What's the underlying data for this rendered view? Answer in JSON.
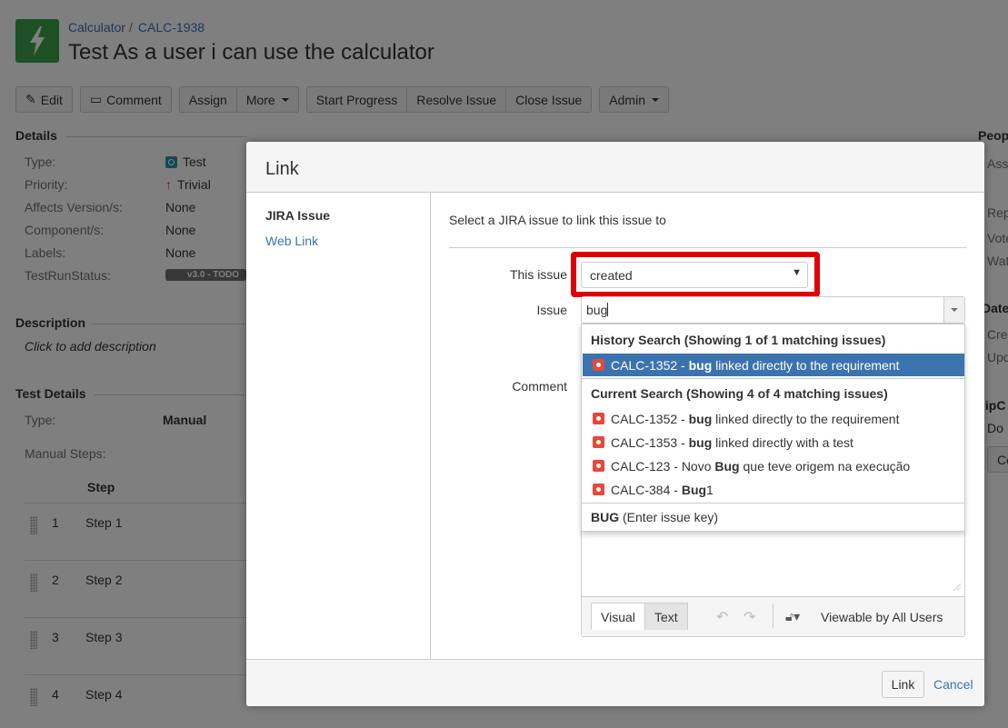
{
  "header": {
    "project": "Calculator",
    "breadcrumb_sep": "/",
    "issue_key": "CALC-1938",
    "title": "Test As a user i can use the calculator"
  },
  "toolbar": {
    "edit": "Edit",
    "comment": "Comment",
    "assign": "Assign",
    "more": "More",
    "start_progress": "Start Progress",
    "resolve_issue": "Resolve Issue",
    "close_issue": "Close Issue",
    "admin": "Admin"
  },
  "details": {
    "heading": "Details",
    "type_label": "Type:",
    "type_value": "Test",
    "priority_label": "Priority:",
    "priority_value": "Trivial",
    "affects_label": "Affects Version/s:",
    "affects_value": "None",
    "component_label": "Component/s:",
    "component_value": "None",
    "labels_label": "Labels:",
    "labels_value": "None",
    "testrun_label": "TestRunStatus:",
    "testrun_value": "v3.0 - TODO"
  },
  "description": {
    "heading": "Description",
    "placeholder": "Click to add description"
  },
  "test_details": {
    "heading": "Test Details",
    "type_label": "Type:",
    "type_value": "Manual",
    "manual_steps_label": "Manual Steps:",
    "step_header": "Step",
    "steps": [
      {
        "num": "1",
        "name": "Step 1"
      },
      {
        "num": "2",
        "name": "Step 2"
      },
      {
        "num": "3",
        "name": "Step 3"
      },
      {
        "num": "4",
        "name": "Step 4"
      }
    ]
  },
  "right_column": {
    "people_heading": "Peop",
    "assignee": "Ass",
    "reporter": "Rep",
    "votes": "Vote",
    "watchers": "Wat",
    "dates_heading": "Dates",
    "created": "Cre",
    "updated": "Upd",
    "hipchat_heading": "lipC",
    "do": "Do",
    "button": "Co"
  },
  "dialog": {
    "title": "Link",
    "nav": {
      "jira_issue": "JIRA Issue",
      "web_link": "Web Link"
    },
    "intro": "Select a JIRA issue to link this issue to",
    "this_issue_label": "This issue",
    "this_issue_value": "created",
    "issue_label": "Issue",
    "issue_value": "bug",
    "comment_label": "Comment",
    "suggestions": {
      "history_heading": "History Search (Showing 1 of 1 matching issues)",
      "history_item": {
        "key": "CALC-1352",
        "pre": " - ",
        "match": "bug",
        "post": " linked directly to the requirement"
      },
      "current_heading": "Current Search (Showing 4 of 4 matching issues)",
      "current_items": [
        {
          "key": "CALC-1352",
          "pre": " - ",
          "match": "bug",
          "post": " linked directly to the requirement"
        },
        {
          "key": "CALC-1353",
          "pre": " - ",
          "match": "bug",
          "post": " linked directly with a test"
        },
        {
          "key": "CALC-123",
          "pre": " - Novo ",
          "match": "Bug",
          "post": " que teve origem na execução"
        },
        {
          "key": "CALC-384",
          "pre": " - ",
          "match": "Bug",
          "post": "1"
        }
      ],
      "footer_key": "BUG",
      "footer_text": " (Enter issue key)"
    },
    "comment_tabs": {
      "visual": "Visual",
      "text": "Text"
    },
    "viewable": "Viewable by All Users",
    "link_button": "Link",
    "cancel": "Cancel"
  },
  "colors": {
    "brand_blue": "#3b73af",
    "highlight_red": "#e00000",
    "logo_green": "#3aa24a",
    "bug_red": "#e5493a"
  }
}
